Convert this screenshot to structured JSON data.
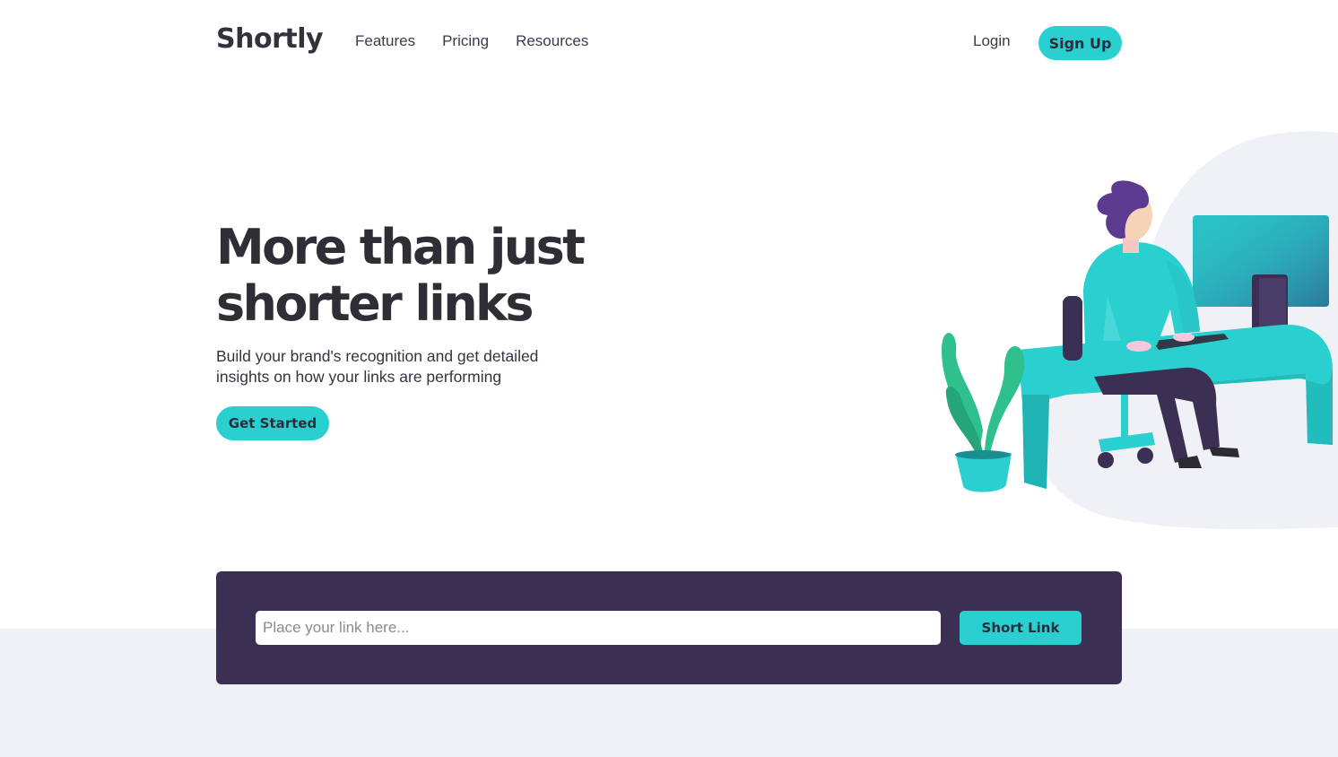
{
  "brand": {
    "logo": "Shortly"
  },
  "nav": {
    "links": [
      {
        "label": "Features"
      },
      {
        "label": "Pricing"
      },
      {
        "label": "Resources"
      }
    ],
    "login_label": "Login",
    "signup_label": "Sign Up"
  },
  "hero": {
    "title_line1": "More than just",
    "title_line2": "shorter links",
    "subtitle": "Build your brand's recognition and get detailed insights on how your links are performing",
    "cta_label": "Get Started",
    "illustration_icon": "person-working-illustration"
  },
  "shorten": {
    "input_placeholder": "Place your link here...",
    "input_value": "",
    "button_label": "Short Link"
  },
  "colors": {
    "accent": "#2acfcf",
    "dark_violet": "#3b3054",
    "text_dark": "#34313d",
    "band_grey": "#f0f1f6"
  }
}
